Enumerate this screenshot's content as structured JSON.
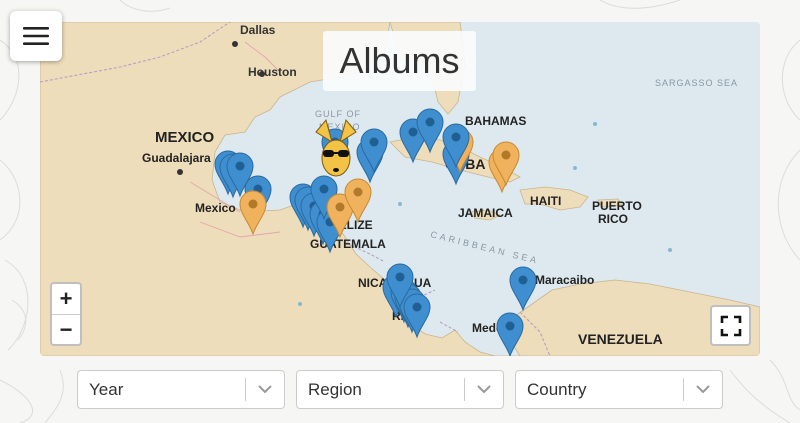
{
  "page_title": "Albums",
  "menu_icon": "hamburger-menu-icon",
  "map": {
    "labels": {
      "dallas": "Dallas",
      "houston": "Houston",
      "mexico": "MEXICO",
      "guadalajara": "Guadalajara",
      "mexico_city": "Mexico",
      "gulf_line1": "GULF OF",
      "gulf_line2": "MEXICO",
      "bahamas": "BAHAMAS",
      "cuba": "CUBA",
      "jamaica": "JAMAICA",
      "haiti": "HAITI",
      "puerto_rico_1": "PUERTO",
      "puerto_rico_2": "RICO",
      "belize": "BELIZE",
      "guatemala": "GUATEMALA",
      "nicaragua": "NICARAGUA",
      "costa_rica": "RICA",
      "maracaibo": "Maracaibo",
      "medellin": "Medellín",
      "venezuela": "VENEZUELA",
      "caribbean_sea": "CARIBBEAN SEA",
      "sargasso_sea": "SARGASSO SEA"
    },
    "marker_colors": {
      "blue": "#3f8fd0",
      "orange": "#f0b25c"
    },
    "mascot_icon": "kangaroo-sunglasses-icon"
  },
  "controls": {
    "zoom_in": "+",
    "zoom_out": "−",
    "fullscreen_icon": "fullscreen-icon"
  },
  "filters": [
    {
      "label": "Year"
    },
    {
      "label": "Region"
    },
    {
      "label": "Country"
    }
  ]
}
